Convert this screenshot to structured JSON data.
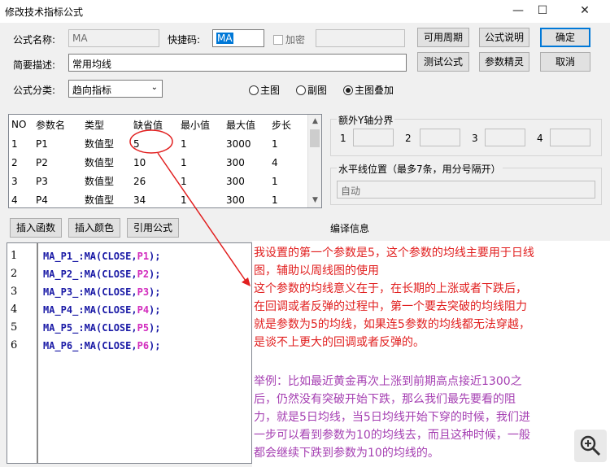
{
  "window": {
    "title": "修改技术指标公式",
    "minimize": "—",
    "maximize": "☐",
    "close": "✕"
  },
  "form": {
    "name_label": "公式名称:",
    "name_value": "MA",
    "shortcut_label": "快捷码:",
    "shortcut_value": "MA",
    "encrypt_label": "加密",
    "desc_label": "简要描述:",
    "desc_value": "常用均线",
    "category_label": "公式分类:",
    "category_value": "趋向指标",
    "radio_main": "主图",
    "radio_sub": "副图",
    "radio_overlay": "主图叠加"
  },
  "buttons": {
    "periods": "可用周期",
    "description": "公式说明",
    "ok": "确定",
    "test": "测试公式",
    "tune": "参数精灵",
    "cancel": "取消",
    "insert_func": "插入函数",
    "insert_color": "插入颜色",
    "reference": "引用公式"
  },
  "params": {
    "headers": [
      "NO",
      "参数名",
      "类型",
      "缺省值",
      "最小值",
      "最大值",
      "步长"
    ],
    "rows": [
      [
        "1",
        "P1",
        "数值型",
        "5",
        "1",
        "3000",
        "1"
      ],
      [
        "2",
        "P2",
        "数值型",
        "10",
        "1",
        "300",
        "4"
      ],
      [
        "3",
        "P3",
        "数值型",
        "26",
        "1",
        "300",
        "1"
      ],
      [
        "4",
        "P4",
        "数值型",
        "34",
        "1",
        "300",
        "1"
      ]
    ]
  },
  "yaxis": {
    "title": "额外Y轴分界",
    "labels": [
      "1",
      "2",
      "3",
      "4"
    ]
  },
  "hline": {
    "title": "水平线位置（最多7条，用分号隔开）",
    "value": "自动"
  },
  "compile_info_label": "编译信息",
  "code": {
    "line_numbers": [
      "1",
      "2",
      "3",
      "4",
      "5",
      "6"
    ],
    "lines": [
      {
        "fn": "MA_P1_:MA(CLOSE,",
        "arg": "P1",
        "end": ");"
      },
      {
        "fn": "MA_P2_:MA(CLOSE,",
        "arg": "P2",
        "end": ");"
      },
      {
        "fn": "MA_P3_:MA(CLOSE,",
        "arg": "P3",
        "end": ");"
      },
      {
        "fn": "MA_P4_:MA(CLOSE,",
        "arg": "P4",
        "end": ");"
      },
      {
        "fn": "MA_P5_:MA(CLOSE,",
        "arg": "P5",
        "end": ");"
      },
      {
        "fn": "MA_P6_:MA(CLOSE,",
        "arg": "P6",
        "end": ");"
      }
    ]
  },
  "annotations": {
    "red_lines": [
      "我设置的第一个参数是5，这个参数的均线主要用于日线",
      "图，辅助以周线图的使用",
      "这个参数的均线意义在于，在长期的上涨或者下跌后，",
      "在回调或者反弹的过程中，第一个要去突破的均线阻力",
      "就是参数为5的均线，如果连5参数的均线都无法穿越，",
      "是谈不上更大的回调或者反弹的。"
    ],
    "purple_lines": [
      "举例：比如最近黄金再次上涨到前期高点接近1300之",
      "后，仍然没有突破开始下跌，那么我们最先要看的阻",
      "力，就是5日均线，当5日均线开始下穿的时候，我们进",
      "一步可以看到参数为10的均线去，而且这种时候，一般",
      "都会继续下跌到参数为10的均线的。"
    ]
  },
  "colors": {
    "annotation_red": "#e11f1f",
    "annotation_purple": "#a53fb2",
    "code_blue": "#1a1aa6",
    "code_param": "#d22bbd"
  }
}
